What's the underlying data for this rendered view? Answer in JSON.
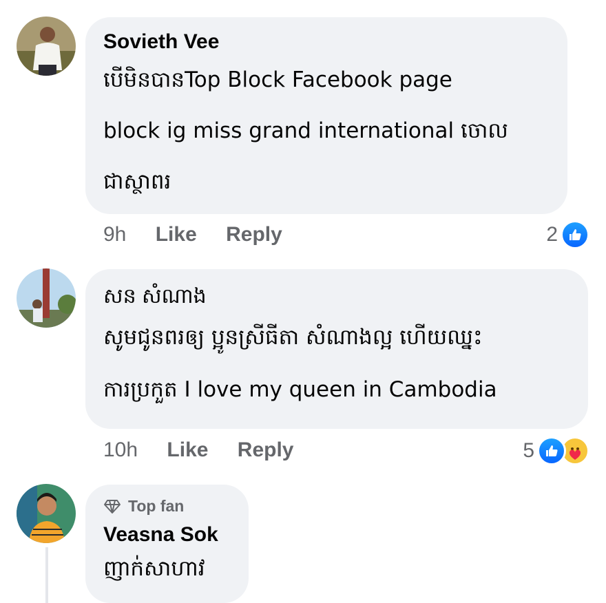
{
  "comments": [
    {
      "author": "Sovieth Vee",
      "lines": [
        "បើមិនបានTop Block Facebook page",
        "block ig miss grand international ចោល",
        "ជាស្ថាពរ"
      ],
      "time": "9h",
      "like_label": "Like",
      "reply_label": "Reply",
      "reaction_count": "2",
      "reactions": [
        "like-icon"
      ]
    },
    {
      "author": "សន សំណាង",
      "lines": [
        "សូមជូនពរឲ្យ ប្អូនស្រីធីតា សំណាងល្អ ហើយឈ្នះ",
        "ការប្រកួត   I love my queen in Cambodia"
      ],
      "time": "10h",
      "like_label": "Like",
      "reply_label": "Reply",
      "reaction_count": "5",
      "reactions": [
        "like-icon",
        "care-icon"
      ]
    },
    {
      "badge": "Top fan",
      "author": "Veasna Sok",
      "lines": [
        "ញាក់សាហាវ"
      ]
    }
  ],
  "colors": {
    "bubble": "#f0f2f5",
    "meta": "#65676b",
    "like_blue": "#0866ff",
    "care_yellow": "#f7c63b"
  }
}
